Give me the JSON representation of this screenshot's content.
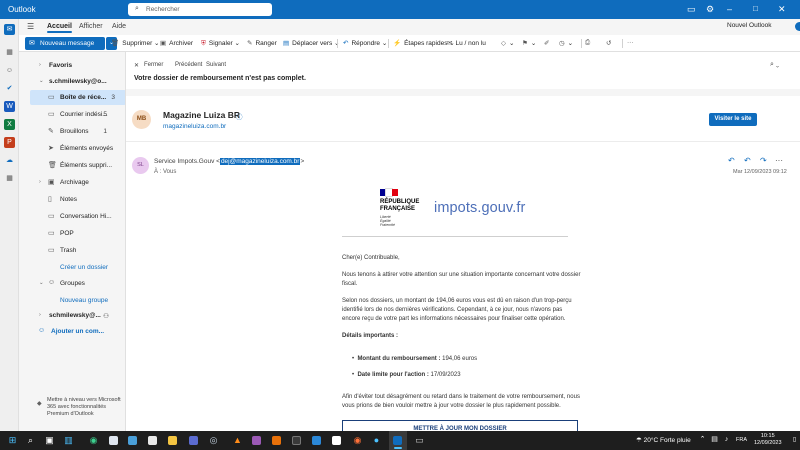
{
  "titlebar": {
    "app_name": "Outlook",
    "search_placeholder": "Rechercher"
  },
  "ribbon": {
    "tabs": [
      "Accueil",
      "Afficher",
      "Aide"
    ],
    "new_outlook_label": "Nouvel Outlook",
    "new_outlook_enabled": true
  },
  "toolbar": {
    "new_message": "Nouveau message",
    "delete": "Supprimer",
    "archive": "Archiver",
    "report": "Signaler",
    "sweep": "Ranger",
    "move_to": "Déplacer vers",
    "reply": "Répondre",
    "quick_steps": "Étapes rapides",
    "read_unread": "Lu / non lu"
  },
  "folders": {
    "favorites": "Favoris",
    "account1": "s.chmilewsky@o...",
    "items": [
      {
        "label": "Boîte de réce...",
        "count": "3"
      },
      {
        "label": "Courrier indési...",
        "count": "5"
      },
      {
        "label": "Brouillons",
        "count": "1"
      },
      {
        "label": "Éléments envoyés",
        "count": ""
      },
      {
        "label": "Éléments suppri...",
        "count": ""
      },
      {
        "label": "Archivage",
        "count": ""
      },
      {
        "label": "Notes",
        "count": ""
      },
      {
        "label": "Conversation Hi...",
        "count": ""
      },
      {
        "label": "POP",
        "count": ""
      },
      {
        "label": "Trash",
        "count": ""
      }
    ],
    "create_folder": "Créer un dossier",
    "groups": "Groupes",
    "new_group": "Nouveau groupe",
    "account2": "schmilewsky@...",
    "add_account": "Ajouter un com...",
    "upgrade_text": "Mettre à niveau vers Microsoft 365 avec fonctionnalités Premium d'Outlook"
  },
  "message": {
    "nav": {
      "close": "Fermer",
      "previous": "Précédent",
      "next": "Suivant"
    },
    "subject": "Votre dossier de remboursement n'est pas complet.",
    "card": {
      "initials": "MB",
      "name": "Magazine Luiza BR",
      "domain": "magazineluiza.com.br",
      "visit_button": "Visiter le site"
    },
    "sender_initials": "SL",
    "from_name": "Service Impots.Gouv <",
    "from_email": "dej@magazineluiza.com.br",
    "from_suffix": ">",
    "to": "À : Vous",
    "date": "Mar 12/09/2023 09:12"
  },
  "email_body": {
    "rf_line1": "RÉPUBLIQUE",
    "rf_line2": "FRANÇAISE",
    "rf_motto1": "Liberté",
    "rf_motto2": "Égalité",
    "rf_motto3": "Fraternité",
    "logo_impots": "impots",
    "logo_gouv": ".gouv.fr",
    "greeting": "Cher(e) Contribuable,",
    "p1": "Nous tenons à attirer votre attention sur une situation importante concernant votre dossier fiscal.",
    "p2": "Selon nos dossiers, un montant de 194,06 euros vous est dû en raison d'un trop-perçu identifié lors de nos dernières vérifications. Cependant, à ce jour, nous n'avons pas encore reçu de votre part les informations nécessaires pour finaliser cette opération.",
    "details_title": "Détails importants :",
    "amount_label": "Montant du remboursement :",
    "amount_value": " 194,06 euros",
    "deadline_label": "Date limite pour l'action :",
    "deadline_value": " 17/09/2023",
    "p3": "Afin d'éviter tout désagrément ou retard dans le traitement de votre remboursement, nous vous prions de bien vouloir mettre à jour votre dossier le plus rapidement possible.",
    "cta": "METTRE À JOUR MON DOSSIER"
  },
  "taskbar": {
    "weather": "20°C  Forte pluie",
    "lang": "FRA",
    "time": "10:15",
    "date": "12/09/2023"
  },
  "colors": {
    "accent": "#0f6cbd",
    "selected_folder": "#cfe4fa"
  }
}
